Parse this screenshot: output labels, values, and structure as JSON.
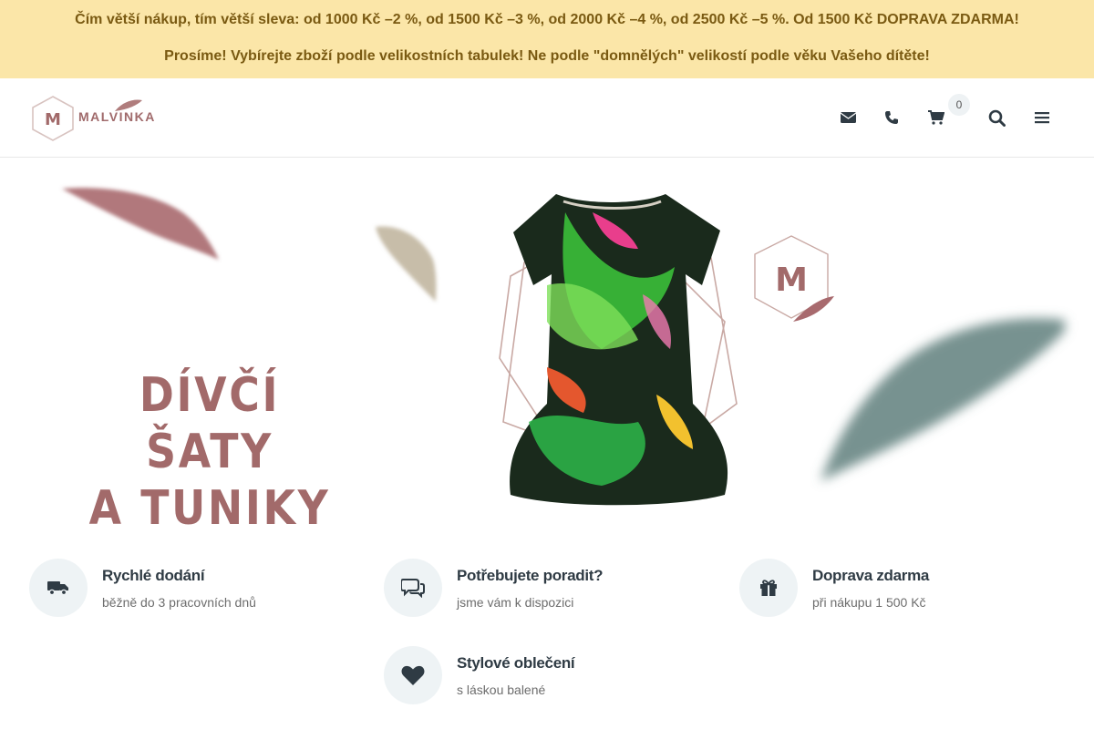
{
  "promo": {
    "line1": " Čím větší nákup, tím větší sleva: od 1000 Kč –2 %, od 1500 Kč –3 %, od 2000 Kč –4 %, od 2500 Kč –5 %. Od 1500 Kč DOPRAVA ZDARMA!",
    "line2": "Prosíme! Vybírejte zboží podle velikostních tabulek! Ne podle \"domnělých\" velikostí podle věku Vašeho dítěte!"
  },
  "header": {
    "logo_text": "MALVINKA",
    "logo_letter": "M",
    "cart_count": "0",
    "icons": [
      "envelope-icon",
      "phone-icon",
      "cart-icon",
      "search-icon",
      "menu-icon"
    ]
  },
  "hero": {
    "title_line1": "DÍVČÍ ŠATY",
    "title_line2": "A TUNIKY",
    "badge_letter": "M"
  },
  "features": [
    {
      "title": "Rychlé dodání",
      "subtitle": "běžně do 3 pracovních dnů",
      "icon": "truck-icon"
    },
    {
      "title": "Potřebujete poradit?",
      "subtitle": "jsme vám k dispozici",
      "icon": "chat-icon"
    },
    {
      "title": "Doprava zdarma",
      "subtitle": "při nákupu 1 500 Kč",
      "icon": "gift-icon"
    },
    {
      "title": "Stylové oblečení",
      "subtitle": "s láskou balené",
      "icon": "heart-icon"
    }
  ],
  "colors": {
    "promo_bg": "#fbe6a8",
    "promo_text": "#7a5a12",
    "brand_rose": "#a26a6a",
    "brand_teal": "#5f7f7d",
    "icon_dark": "#2f3b44"
  }
}
